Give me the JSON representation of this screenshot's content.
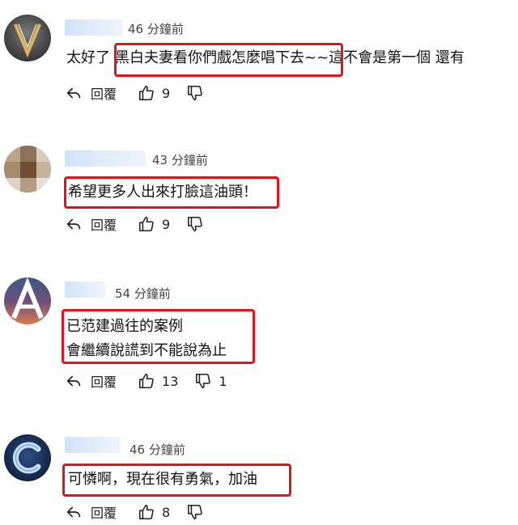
{
  "comments": [
    {
      "time": "46 分鐘前",
      "text_pre": "太好了",
      "text_hl": "黑白夫妻看你們戲怎麼唱下去",
      "text_post": "~~這不會是第一個 還有",
      "reply_label": "回覆",
      "likes": "9",
      "dislikes": ""
    },
    {
      "time": "43 分鐘前",
      "line1": "希望更多人出來打臉這油頭！",
      "reply_label": "回覆",
      "likes": "9",
      "dislikes": ""
    },
    {
      "time": "54 分鐘前",
      "line1": "已范建過往的案例",
      "line2": "會繼續說謊到不能說為止",
      "reply_label": "回覆",
      "likes": "13",
      "dislikes": "1"
    },
    {
      "time": "46 分鐘前",
      "line1": "可憐啊，現在很有勇氣，加油",
      "reply_label": "回覆",
      "likes": "8",
      "dislikes": ""
    }
  ],
  "colors": {
    "highlight": "#e0141c",
    "name_blur": "#d6e6f8"
  },
  "icons": [
    "reply-arrow-icon",
    "thumbs-up-icon",
    "thumbs-down-icon"
  ]
}
